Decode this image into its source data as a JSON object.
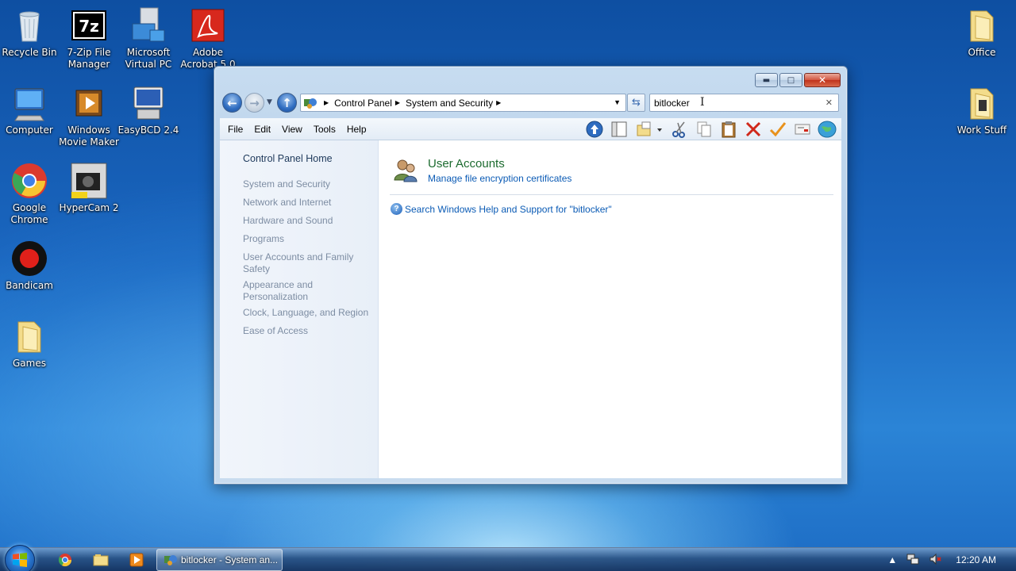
{
  "desktop": {
    "icons": [
      {
        "label": "Recycle Bin"
      },
      {
        "label": "7-Zip File Manager"
      },
      {
        "label": "Microsoft Virtual PC"
      },
      {
        "label": "Adobe Acrobat 5.0"
      },
      {
        "label": "Computer"
      },
      {
        "label": "Windows Movie Maker"
      },
      {
        "label": "EasyBCD 2.4"
      },
      {
        "label": "Google Chrome"
      },
      {
        "label": "HyperCam 2"
      },
      {
        "label": "Bandicam"
      },
      {
        "label": "Games"
      },
      {
        "label": "Office"
      },
      {
        "label": "Work Stuff"
      }
    ]
  },
  "window": {
    "breadcrumb": [
      "Control Panel",
      "System and Security"
    ],
    "search": {
      "value": "bitlocker"
    },
    "menu": [
      "File",
      "Edit",
      "View",
      "Tools",
      "Help"
    ],
    "left_pane": {
      "home": "Control Panel Home",
      "categories": [
        "System and Security",
        "Network and Internet",
        "Hardware and Sound",
        "Programs",
        "User Accounts and Family Safety",
        "Appearance and Personalization",
        "Clock, Language, and Region",
        "Ease of Access"
      ]
    },
    "results": {
      "group_title": "User Accounts",
      "group_link": "Manage file encryption certificates",
      "help_link": "Search Windows Help and Support for \"bitlocker\""
    }
  },
  "taskbar": {
    "active_task": "bitlocker - System an...",
    "clock": "12:20 AM"
  },
  "colors": {
    "link": "#0b5bb5",
    "group_title": "#1c6b2f",
    "left_pane_text": "#7d8da3"
  }
}
